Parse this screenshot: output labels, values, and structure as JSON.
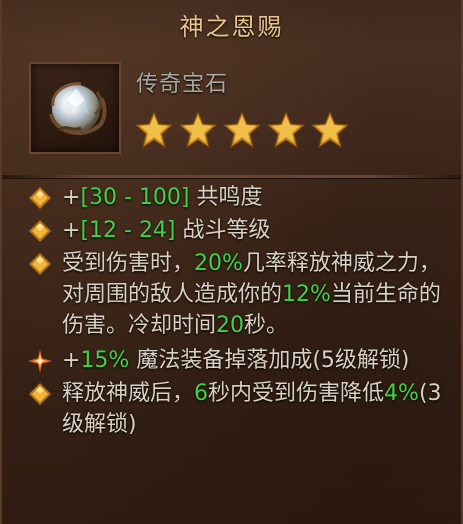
{
  "title": "神之恩赐",
  "gem": {
    "icon": "legendary-gem-icon",
    "type_label": "传奇宝石",
    "rank_icons": [
      "unknown-rank-star-icon",
      "unknown-rank-star-icon",
      "unknown-rank-star-icon",
      "unknown-rank-star-icon",
      "unknown-rank-star-icon"
    ],
    "rank_glyph": "?"
  },
  "colors": {
    "title": "#e9c58d",
    "text": "#d8d2c6",
    "value": "#3fd24a",
    "bullet": "#f2b53a"
  },
  "affixes": [
    {
      "icon": "gold-diamond-bullet-icon",
      "parts": [
        {
          "t": "+"
        },
        {
          "t": "[30 - 100]",
          "v": true
        },
        {
          "t": " 共鸣度"
        }
      ]
    },
    {
      "icon": "gold-diamond-bullet-icon",
      "parts": [
        {
          "t": "+"
        },
        {
          "t": "[12 - 24]",
          "v": true
        },
        {
          "t": " 战斗等级"
        }
      ]
    },
    {
      "icon": "gold-diamond-bullet-icon",
      "parts": [
        {
          "t": "受到伤害时，"
        },
        {
          "t": "20%",
          "v": true
        },
        {
          "t": "几率释放神威之力，对周围的敌人造成你的"
        },
        {
          "t": "12%",
          "v": true
        },
        {
          "t": "当前生命的伤害。冷却时间"
        },
        {
          "t": "20",
          "v": true
        },
        {
          "t": "秒。"
        }
      ]
    },
    {
      "icon": "orange-starburst-bullet-icon",
      "parts": [
        {
          "t": "+"
        },
        {
          "t": "15%",
          "v": true
        },
        {
          "t": " 魔法装备掉落加成(5级解锁)"
        }
      ]
    },
    {
      "icon": "gold-diamond-bullet-icon",
      "parts": [
        {
          "t": "释放神威后，"
        },
        {
          "t": "6",
          "v": true
        },
        {
          "t": "秒内受到伤害降低"
        },
        {
          "t": "4%",
          "v": true
        },
        {
          "t": "(3级解锁)"
        }
      ]
    }
  ]
}
